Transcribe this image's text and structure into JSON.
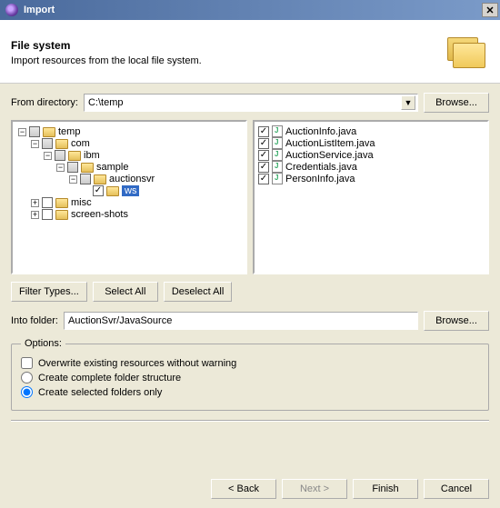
{
  "window": {
    "title": "Import"
  },
  "banner": {
    "heading": "File system",
    "subtext": "Import resources from the local file system."
  },
  "from_dir": {
    "label": "From directory:",
    "value": "C:\\temp",
    "browse": "Browse..."
  },
  "tree": {
    "root": "temp",
    "nodes": {
      "com": "com",
      "ibm": "ibm",
      "sample": "sample",
      "auctionsvr": "auctionsvr",
      "ws": "ws",
      "misc": "misc",
      "screenshots": "screen-shots"
    }
  },
  "files": [
    "AuctionInfo.java",
    "AuctionListItem.java",
    "AuctionService.java",
    "Credentials.java",
    "PersonInfo.java"
  ],
  "buttons": {
    "filter": "Filter Types...",
    "select_all": "Select All",
    "deselect_all": "Deselect All"
  },
  "into_folder": {
    "label": "Into folder:",
    "value": "AuctionSvr/JavaSource",
    "browse": "Browse..."
  },
  "options": {
    "legend": "Options:",
    "overwrite": "Overwrite existing resources without warning",
    "complete": "Create complete folder structure",
    "selected": "Create selected folders only"
  },
  "wizard": {
    "back": "< Back",
    "next": "Next >",
    "finish": "Finish",
    "cancel": "Cancel"
  }
}
